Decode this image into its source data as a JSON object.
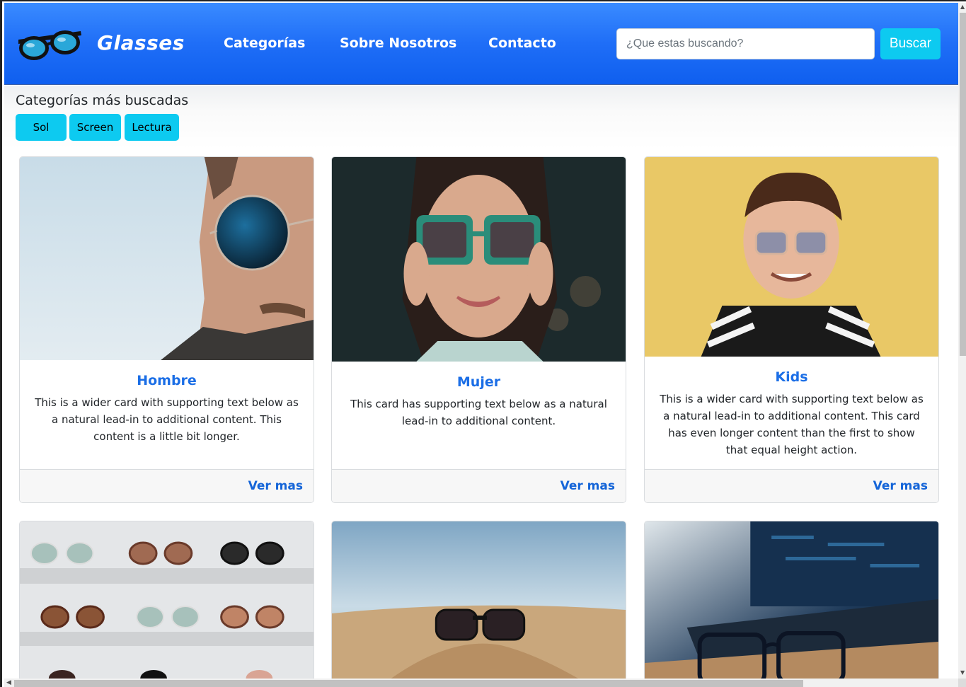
{
  "navbar": {
    "brand": "Glasses",
    "links": [
      "Categorías",
      "Sobre Nosotros",
      "Contacto"
    ],
    "search_placeholder": "¿Que estas buscando?",
    "search_button": "Buscar",
    "background": "#1f6ef7",
    "logo_icon": "sunglasses-icon"
  },
  "categories": {
    "title": "Categorías más buscadas",
    "buttons": [
      "Sol",
      "Screen",
      "Lectura"
    ],
    "accent": "#0dcaf0"
  },
  "cards": [
    {
      "title": "Hombre",
      "text": "This is a wider card with supporting text below as a natural lead-in to additional content. This content is a little bit longer.",
      "link": "Ver mas"
    },
    {
      "title": "Mujer",
      "text": "This card has supporting text below as a natural lead-in to additional content.",
      "link": "Ver mas"
    },
    {
      "title": "Kids",
      "text": "This is a wider card with supporting text below as a natural lead-in to additional content. This card has even longer content than the first to show that equal height action.",
      "link": "Ver mas"
    }
  ],
  "colors": {
    "link": "#1565d8",
    "card_title": "#1b6ee6"
  }
}
